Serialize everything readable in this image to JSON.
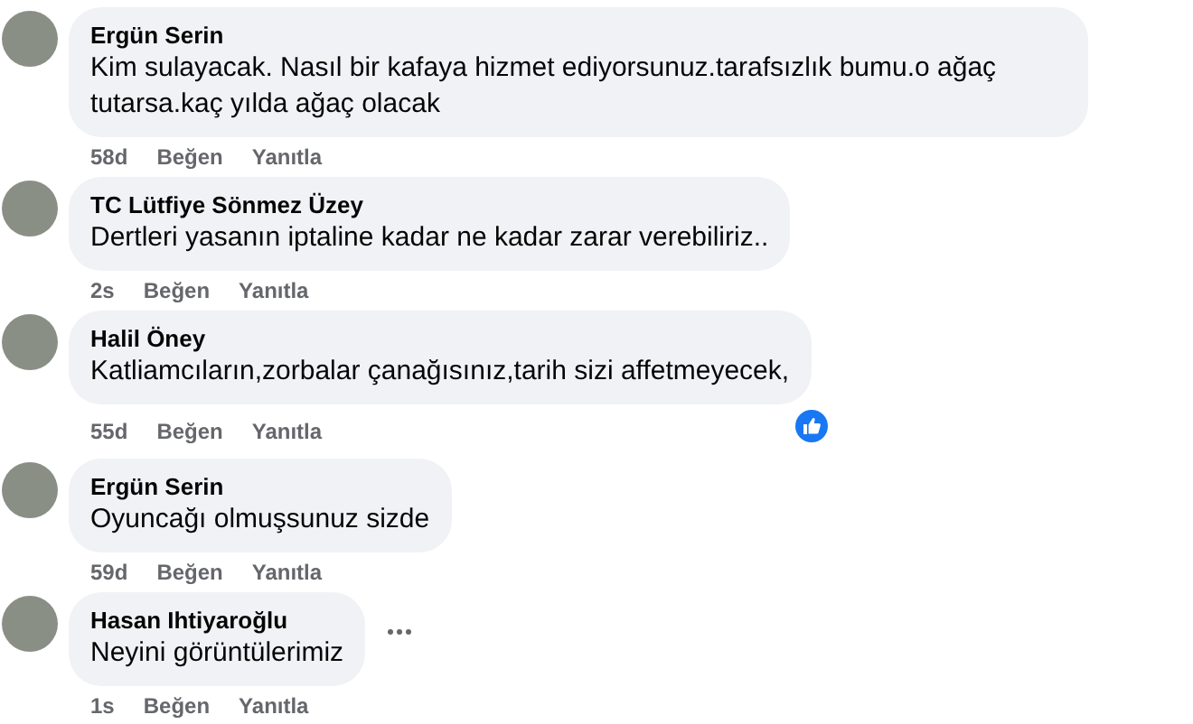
{
  "comments": [
    {
      "author": "Ergün Serin",
      "text": "Kim sulayacak. Nasıl bir kafaya hizmet ediyorsunuz.tarafsızlık bumu.o ağaç tutarsa.kaç yılda ağaç olacak",
      "time": "58d",
      "like": "Beğen",
      "reply": "Yanıtla",
      "reacted": false,
      "menu_visible": false
    },
    {
      "author": "TC Lütfiye Sönmez Üzey",
      "text": "Dertleri yasanın iptaline kadar ne kadar zarar verebiliriz..",
      "time": "2s",
      "like": "Beğen",
      "reply": "Yanıtla",
      "reacted": false,
      "menu_visible": false
    },
    {
      "author": "Halil Öney",
      "text": "Katliamcıların,zorbalar çanağısınız,tarih sizi affetmeyecek,",
      "time": "55d",
      "like": "Beğen",
      "reply": "Yanıtla",
      "reacted": true,
      "menu_visible": false
    },
    {
      "author": "Ergün Serin",
      "text": "Oyuncağı olmuşsunuz sizde",
      "time": "59d",
      "like": "Beğen",
      "reply": "Yanıtla",
      "reacted": false,
      "menu_visible": false
    },
    {
      "author": "Hasan Ihtiyaroğlu",
      "text": "Neyini görüntülerimiz",
      "time": "1s",
      "like": "Beğen",
      "reply": "Yanıtla",
      "reacted": false,
      "menu_visible": true
    }
  ]
}
